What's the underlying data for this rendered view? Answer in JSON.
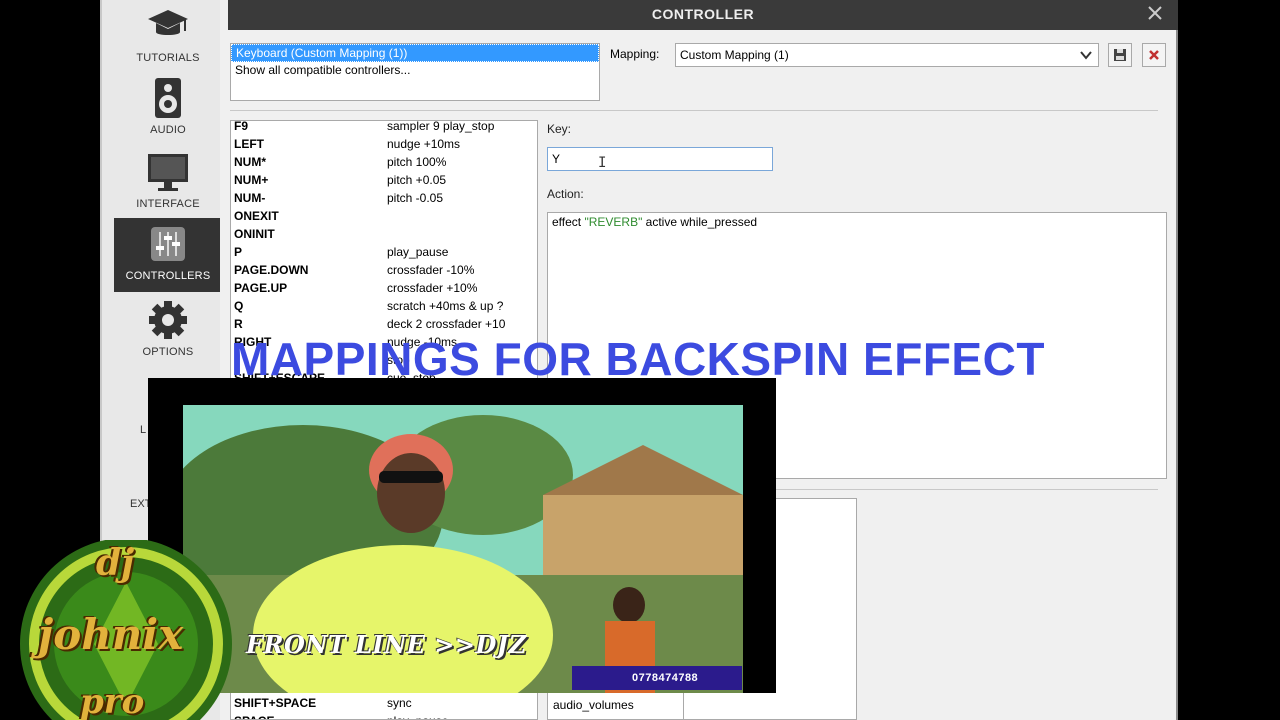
{
  "sidebar": {
    "items": [
      {
        "label": "TUTORIALS",
        "icon": "graduation-cap-icon"
      },
      {
        "label": "AUDIO",
        "icon": "speaker-icon"
      },
      {
        "label": "INTERFACE",
        "icon": "monitor-icon"
      },
      {
        "label": "CONTROLLERS",
        "icon": "sliders-icon",
        "active": true
      },
      {
        "label": "OPTIONS",
        "icon": "gear-icon"
      }
    ],
    "partial": [
      "L",
      "EXT"
    ]
  },
  "window": {
    "title": "CONTROLLER",
    "controllers": [
      "Keyboard (Custom Mapping (1))",
      "Show all compatible controllers..."
    ],
    "mapping_label": "Mapping:",
    "mapping_value": "Custom Mapping (1)",
    "key_label": "Key:",
    "key_value": "Y",
    "action_label": "Action:",
    "action": {
      "pre": "effect ",
      "str": "\"REVERB\"",
      "post": " active while_pressed"
    }
  },
  "keys": [
    {
      "key": "F9",
      "action": "sampler 9 play_stop"
    },
    {
      "key": "LEFT",
      "action": "nudge +10ms"
    },
    {
      "key": "NUM*",
      "action": "pitch 100%"
    },
    {
      "key": "NUM+",
      "action": "pitch +0.05"
    },
    {
      "key": "NUM-",
      "action": "pitch -0.05"
    },
    {
      "key": "ONEXIT",
      "action": ""
    },
    {
      "key": "ONINIT",
      "action": ""
    },
    {
      "key": "P",
      "action": "play_pause"
    },
    {
      "key": "PAGE.DOWN",
      "action": "crossfader -10%"
    },
    {
      "key": "PAGE.UP",
      "action": "crossfader +10%"
    },
    {
      "key": "Q",
      "action": "scratch +40ms & up ?"
    },
    {
      "key": "R",
      "action": "deck 2 crossfader +10"
    },
    {
      "key": "RIGHT",
      "action": "nudge -10ms"
    },
    {
      "key": "",
      "action": "stop"
    },
    {
      "key": "SHIFT+ESCAPE",
      "action": "cue_stop"
    }
  ],
  "keys_bottom": [
    {
      "key": "SHIFT+SPACE",
      "action": "sync"
    },
    {
      "key": "SPACE",
      "action": "play_pause"
    }
  ],
  "lower_list": [
    "audio_volumes"
  ],
  "overlay": {
    "banner": "MAPPINGS FOR BACKSPIN EFFECT",
    "front_line": "FRONT LINE   >>DJZ",
    "phone": "0778474788",
    "logo": [
      "dj",
      "johnix",
      "pro"
    ]
  },
  "colors": {
    "selection": "#3399ff",
    "banner": "#3c4be0",
    "action_string": "#2e8b2e",
    "titlebar": "#3a3a3a"
  }
}
